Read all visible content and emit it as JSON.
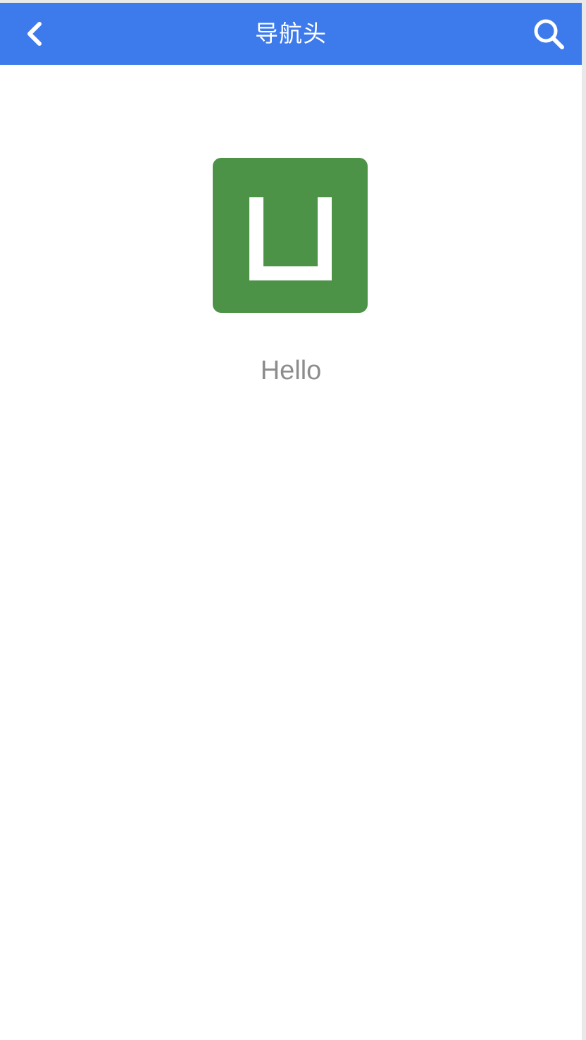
{
  "navbar": {
    "title": "导航头",
    "back_icon": "chevron-left-icon",
    "search_icon": "search-icon",
    "color": "#3d7bec"
  },
  "content": {
    "logo_icon": "uniapp-logo",
    "logo_color": "#4d9347",
    "text": "Hello"
  }
}
